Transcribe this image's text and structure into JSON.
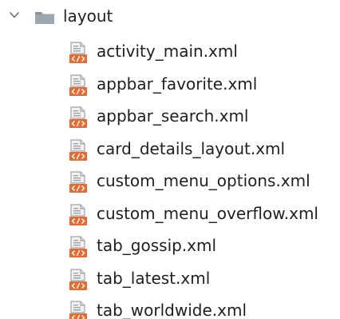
{
  "tree": {
    "folder": {
      "name": "layout",
      "expanded": true,
      "chevron_icon": "chevron-down-icon",
      "icon": "folder-icon",
      "icon_color": "#9aa7b0"
    },
    "file_icon": "xml-layout-file-icon",
    "file_icon_accent": "#e56b2e",
    "files": [
      {
        "name": "activity_main.xml"
      },
      {
        "name": "appbar_favorite.xml"
      },
      {
        "name": "appbar_search.xml"
      },
      {
        "name": "card_details_layout.xml"
      },
      {
        "name": "custom_menu_options.xml"
      },
      {
        "name": "custom_menu_overflow.xml"
      },
      {
        "name": "tab_gossip.xml"
      },
      {
        "name": "tab_latest.xml"
      },
      {
        "name": "tab_worldwide.xml"
      }
    ]
  }
}
